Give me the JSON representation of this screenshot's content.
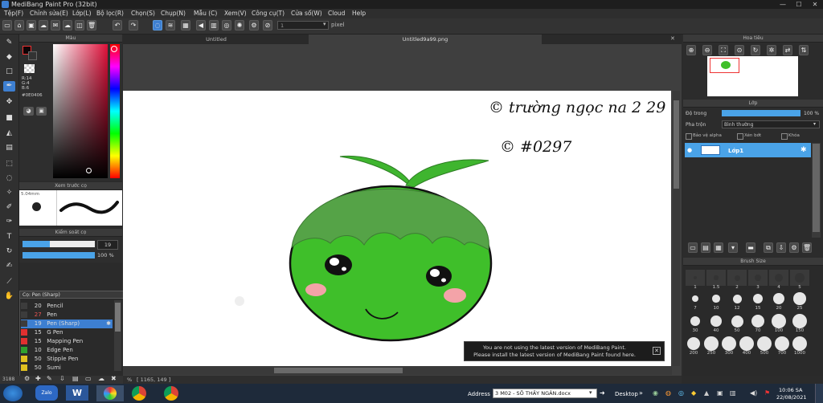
{
  "app": {
    "title": "MediBang Paint Pro (32bit)"
  },
  "menu": [
    "Tệp(F)",
    "Chỉnh sửa(E)",
    "Lớp(L)",
    "Bộ lọc(R)",
    "Chọn(S)",
    "Chụp(N)",
    "Mẫu (C)",
    "Xem(V)",
    "Công cụ(T)",
    "Cửa sổ(W)",
    "Cloud",
    "Help"
  ],
  "toolbar": {
    "size_value": "1",
    "unit": "pixel"
  },
  "tabs": [
    "Untitled",
    "Untitled9a99.png"
  ],
  "color_panel": {
    "title": "Màu",
    "r": "R:14",
    "g": "G:4",
    "b": "B:6",
    "hex": "#0E0406",
    "primary": "#0e0406"
  },
  "brush_preview": {
    "title": "Xem trước cọ",
    "size": "5.04mm"
  },
  "brush_control": {
    "title": "Kiểm soát cọ",
    "size_value": "19",
    "opacity_value": "100 %"
  },
  "brush_list": {
    "title": "Cọ: Pen (Sharp)",
    "items": [
      {
        "size": "20",
        "name": "Pencil",
        "color": "#3c3c3c"
      },
      {
        "size": "27",
        "name": "Pen",
        "color": "#3c3c3c"
      },
      {
        "size": "19",
        "name": "Pen (Sharp)",
        "color": "#3c3c3c",
        "selected": true
      },
      {
        "size": "15",
        "name": "G Pen",
        "color": "#e03030"
      },
      {
        "size": "15",
        "name": "Mapping Pen",
        "color": "#e03030"
      },
      {
        "size": "10",
        "name": "Edge Pen",
        "color": "#2fa02f"
      },
      {
        "size": "50",
        "name": "Stipple Pen",
        "color": "#e0c020"
      },
      {
        "size": "50",
        "name": "Sumi",
        "color": "#e0c020"
      }
    ]
  },
  "navigator": {
    "title": "Hoa tiêu"
  },
  "layers": {
    "title": "Lớp",
    "opacity_label": "Độ trong",
    "opacity_value": "100 %",
    "blend_label": "Pha trộn",
    "blend_value": "Bình thường",
    "protect_alpha": "Bảo vệ alpha",
    "clipping": "Xén bớt",
    "lock": "Khóa",
    "layer_name": "Lớp1"
  },
  "brush_size": {
    "title": "Brush Size",
    "rows": [
      [
        "1",
        "1.5",
        "2",
        "3",
        "4",
        "5"
      ],
      [
        "7",
        "10",
        "12",
        "15",
        "20",
        "25"
      ],
      [
        "30",
        "40",
        "50",
        "70",
        "100",
        "150"
      ],
      [
        "200",
        "250",
        "300",
        "400",
        "500",
        "700",
        "1000"
      ]
    ]
  },
  "drawing_text": {
    "line1": "© trường ngọc na 2 29",
    "line2": "© #0297"
  },
  "notification": {
    "line1": "You are not using the latest version of MediBang Paint.",
    "line2": "Please install the latest version of MediBang Paint found here."
  },
  "status": {
    "zoom": "%",
    "coords": "[ 1165, 149 ]",
    "left_number": "3188"
  },
  "taskbar": {
    "address_label": "Address",
    "address_value": "3 M02 - SỐ THẦY NGÂN.docx",
    "desktop": "Desktop",
    "time": "10:06 SA",
    "date": "22/08/2021"
  }
}
